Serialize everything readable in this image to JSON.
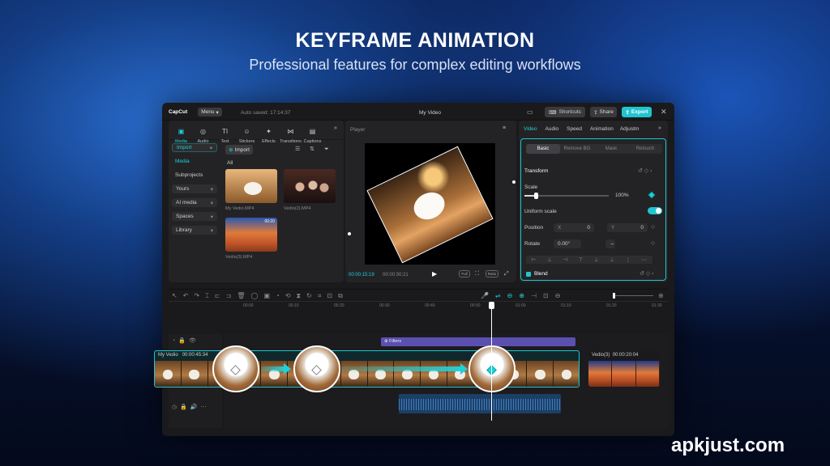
{
  "hero": {
    "title": "KEYFRAME ANIMATION",
    "subtitle": "Professional features for complex editing workflows"
  },
  "watermark": "apkjust.com",
  "titlebar": {
    "logo": "CapCut",
    "menu": "Menu",
    "autosave": "Auto saved: 17:14:37",
    "project": "My Video",
    "shortcuts": "Shortcuts",
    "share": "Share",
    "export": "Export"
  },
  "toolbar": [
    {
      "icon": "media-icon",
      "label": "Media"
    },
    {
      "icon": "audio-icon",
      "label": "Audio"
    },
    {
      "icon": "text-icon",
      "label": "Text"
    },
    {
      "icon": "stickers-icon",
      "label": "Stickers"
    },
    {
      "icon": "effects-icon",
      "label": "Effects"
    },
    {
      "icon": "transitions-icon",
      "label": "Transitions"
    },
    {
      "icon": "captions-icon",
      "label": "Captions"
    }
  ],
  "sidebar": {
    "import_select": "Import",
    "items": [
      "Media",
      "Subprojects"
    ],
    "groups": [
      "Yours",
      "AI media",
      "Spaces",
      "Library"
    ]
  },
  "media": {
    "import_button": "Import",
    "section": "All",
    "items": [
      {
        "name": "My Vedio.MP4",
        "duration": ""
      },
      {
        "name": "Vedio(2).MP4",
        "duration": ""
      },
      {
        "name": "Vedio(3).MP4",
        "duration": "00:20"
      }
    ]
  },
  "player": {
    "label": "Player",
    "current": "00:00:15:19",
    "total": "00:00:30:21",
    "btn_full": "Full",
    "btn_ratio": "Ratio"
  },
  "inspector": {
    "tabs": [
      "Video",
      "Audio",
      "Speed",
      "Animation",
      "Adjustm"
    ],
    "subtabs": [
      "Basic",
      "Remove BG",
      "Mask",
      "Retouch"
    ],
    "transform": "Transform",
    "scale_label": "Scale",
    "scale_value": "100%",
    "scale_fraction": 0.13,
    "uniform": "Uniform scale",
    "position_label": "Position",
    "pos_x_label": "X",
    "pos_x": "0",
    "pos_y_label": "Y",
    "pos_y": "0",
    "rotate_label": "Rotate",
    "rotate_value": "0.00°",
    "blend": "Blend"
  },
  "timeline": {
    "ticks": [
      "00:00",
      "00:10",
      "00:20",
      "00:30",
      "00:40",
      "00:50",
      "01:00",
      "01:10",
      "01:20",
      "01:30"
    ],
    "filters": "Filters",
    "clip1_name": "My Vedio",
    "clip1_dur": "00:00:45:34",
    "clip2_name": "Vedio(3)",
    "clip2_dur": "00:00:20:04"
  }
}
